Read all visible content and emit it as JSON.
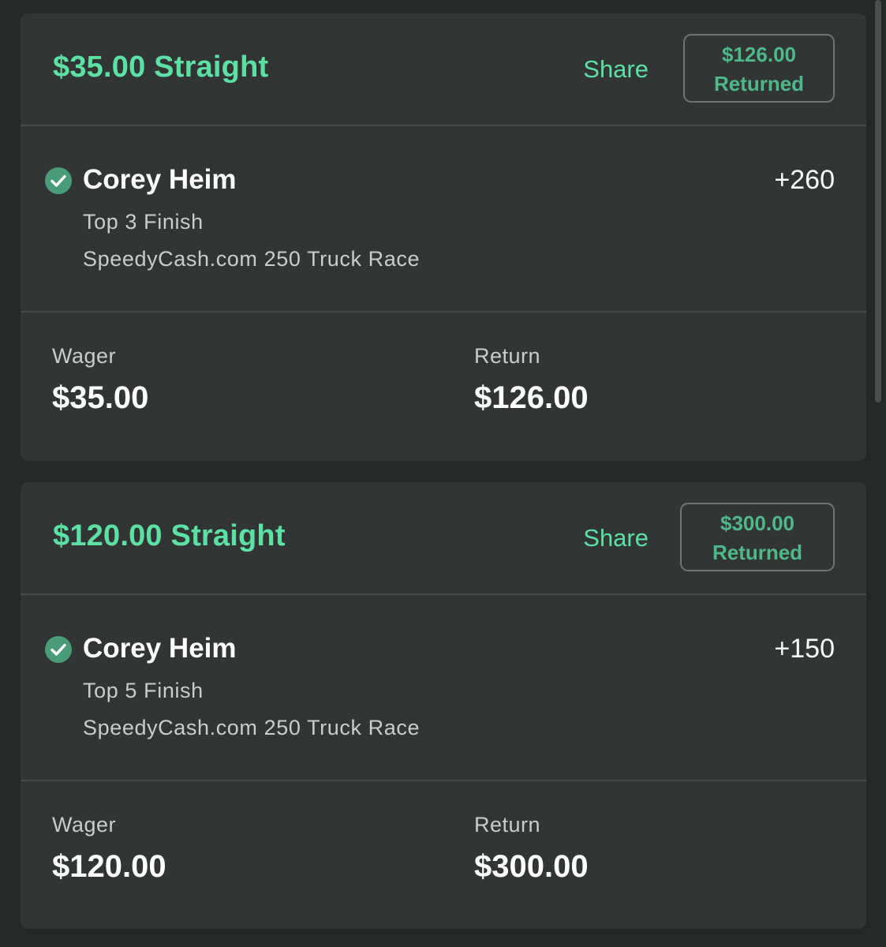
{
  "bets": [
    {
      "title": "$35.00 Straight",
      "share_label": "Share",
      "returned_amount": "$126.00",
      "returned_label": "Returned",
      "leg": {
        "status": "check-icon",
        "runner": "Corey Heim",
        "odds": "+260",
        "market": "Top 3 Finish",
        "event": "SpeedyCash.com 250 Truck Race"
      },
      "wager_label": "Wager",
      "wager_value": "$35.00",
      "return_label": "Return",
      "return_value": "$126.00"
    },
    {
      "title": "$120.00 Straight",
      "share_label": "Share",
      "returned_amount": "$300.00",
      "returned_label": "Returned",
      "leg": {
        "status": "check-icon",
        "runner": "Corey Heim",
        "odds": "+150",
        "market": "Top 5 Finish",
        "event": "SpeedyCash.com 250 Truck Race"
      },
      "wager_label": "Wager",
      "wager_value": "$120.00",
      "return_label": "Return",
      "return_value": "$300.00"
    }
  ],
  "colors": {
    "background": "#262828",
    "card": "#313634",
    "accent": "#5de0a3",
    "badge_text": "#4fb889",
    "check": "#4a9c78"
  }
}
